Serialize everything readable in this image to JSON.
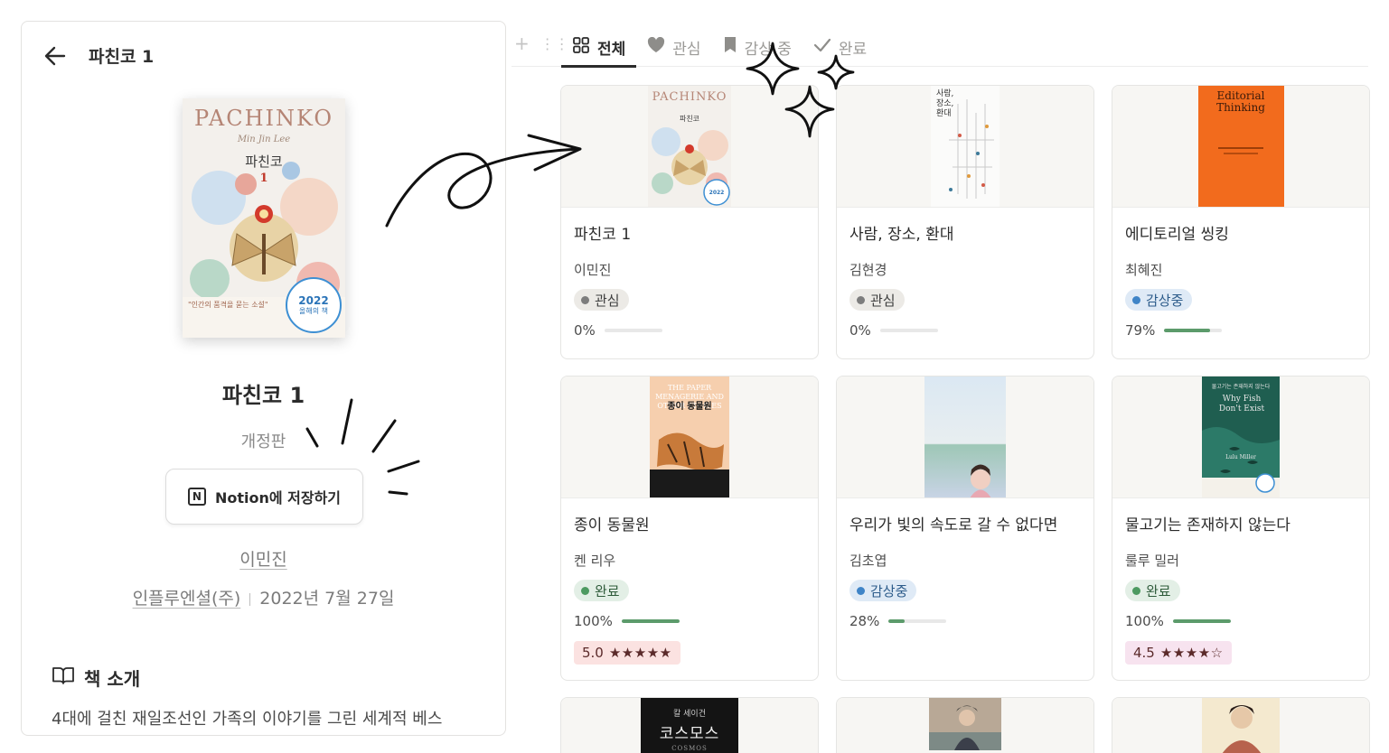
{
  "panel": {
    "title": "파친코 1",
    "cover": {
      "title_en": "PACHINKO",
      "author_en": "Min Jin Lee",
      "title_ko": "파친코",
      "volume": "1",
      "badge_year": "2022",
      "badge_text": "올해의 책",
      "quote": "\"인간의 품격을 묻는 소설\""
    },
    "book_title": "파친코 1",
    "edition": "개정판",
    "save_label": "Notion에 저장하기",
    "author": "이민진",
    "publisher": "인플루엔셜(주)",
    "date": "2022년 7월 27일",
    "intro_heading": "책 소개",
    "intro_text": "4대에 걸친 재일조선인 가족의 이야기를 그린 세계적 베스"
  },
  "tabs": {
    "tools": [
      "+",
      "⋮⋮"
    ],
    "items": [
      {
        "label": "전체",
        "icon": "grid-icon",
        "active": true
      },
      {
        "label": "관심",
        "icon": "heart-icon",
        "active": false
      },
      {
        "label": "감상 중",
        "icon": "bookmark-icon",
        "active": false
      },
      {
        "label": "완료",
        "icon": "check-icon",
        "active": false
      }
    ]
  },
  "cards": [
    {
      "title": "파친코 1",
      "author": "이민진",
      "status": "관심",
      "status_color": "gray",
      "progress": 0,
      "progress_label": "0%",
      "rating": ""
    },
    {
      "title": "사람, 장소, 환대",
      "author": "김현경",
      "status": "관심",
      "status_color": "gray",
      "progress": 0,
      "progress_label": "0%",
      "rating": ""
    },
    {
      "title": "에디토리얼 씽킹",
      "author": "최혜진",
      "status": "감상중",
      "status_color": "blue",
      "progress": 79,
      "progress_label": "79%",
      "rating": ""
    },
    {
      "title": "종이 동물원",
      "author": "켄 리우",
      "status": "완료",
      "status_color": "green",
      "progress": 100,
      "progress_label": "100%",
      "rating": "5.0",
      "stars": "★★★★★",
      "rating_color": "red"
    },
    {
      "title": "우리가 빛의 속도로 갈 수 없다면",
      "author": "김초엽",
      "status": "감상중",
      "status_color": "blue",
      "progress": 28,
      "progress_label": "28%",
      "rating": ""
    },
    {
      "title": "물고기는 존재하지 않는다",
      "author": "룰루 밀러",
      "status": "완료",
      "status_color": "green",
      "progress": 100,
      "progress_label": "100%",
      "rating": "4.5",
      "stars": "★★★★☆",
      "rating_color": "pink"
    },
    {
      "title": "",
      "author": "",
      "status": "",
      "progress": null,
      "rating": ""
    },
    {
      "title": "",
      "author": "",
      "status": "",
      "progress": null,
      "rating": ""
    },
    {
      "title": "",
      "author": "",
      "status": "",
      "progress": null,
      "rating": ""
    }
  ],
  "covers": {
    "c2_title": "사람,\n장소,\n환대",
    "c3_title": "Editorial\nThinking",
    "c4_title": "종이 동물원",
    "c4_en": "THE PAPER MENAGERIE AND OTHER STORIES",
    "c6_title": "Why Fish Don't Exist",
    "c6_top": "물고기는 존재하지 않는다",
    "c6_author": "Lulu Miller",
    "c7_top": "칼 세이건",
    "c7_title": "코스모스",
    "c7_en": "COSMOS"
  },
  "colors": {
    "accent_green": "#5c9b6b",
    "status_blue": "#3f84c7",
    "editorial_orange": "#f26b1d",
    "cosmos_dark": "#1a1a1a"
  }
}
